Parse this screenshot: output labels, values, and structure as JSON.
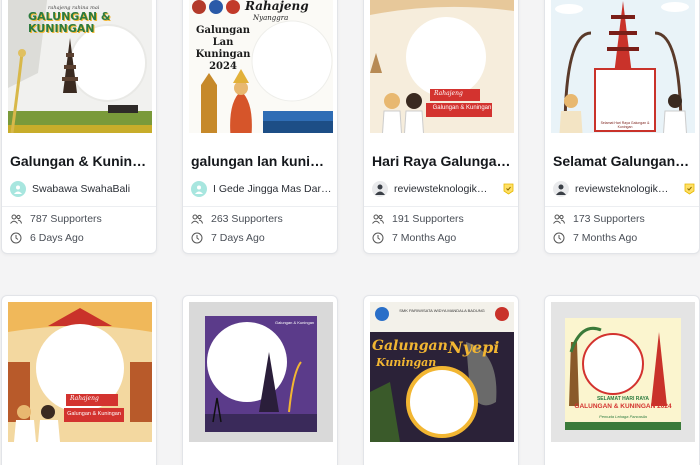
{
  "cards": [
    {
      "title": "Galungan & Kunin…",
      "author": "Swabawa SwahaBali",
      "supporters": "787 Supporters",
      "age": "6 Days Ago",
      "avatar_color": "#a8e6df",
      "verified": false,
      "thumb_text": {
        "top": "rahajeng rahina mai",
        "main": "GALUNGAN & KUNINGAN"
      }
    },
    {
      "title": "galungan lan kunin…",
      "author": "I Gede Jingga Mas Dars…",
      "supporters": "263 Supporters",
      "age": "7 Days Ago",
      "avatar_color": "#a8e6df",
      "verified": false,
      "thumb_text": {
        "top": "Rahajeng",
        "sub": "Nyanggra",
        "main": "Galungan Lan Kuningan 2024"
      }
    },
    {
      "title": "Hari Raya Galunga…",
      "author": "reviewsteknologik…",
      "supporters": "191 Supporters",
      "age": "7 Months Ago",
      "avatar_color": "#3a3f46",
      "verified": true,
      "thumb_text": {
        "top": "Rahajeng",
        "main": "Galungan & Kuningan"
      }
    },
    {
      "title": "Selamat Galungan …",
      "author": "reviewsteknologik…",
      "supporters": "173 Supporters",
      "age": "7 Months Ago",
      "avatar_color": "#3a3f46",
      "verified": true,
      "thumb_text": {
        "top": "Selamat Hari Raya Galungan & Kuningan"
      }
    },
    {
      "title": "",
      "author": "",
      "supporters": "",
      "age": "",
      "avatar_color": "#a8e6df",
      "verified": false,
      "thumb_text": {
        "top": "Rahajeng",
        "main": "Galungan & Kuningan"
      }
    },
    {
      "title": "",
      "author": "",
      "supporters": "",
      "age": "",
      "avatar_color": "#a8e6df",
      "verified": false,
      "thumb_text": {
        "top": "Galungan & Kuningan"
      }
    },
    {
      "title": "",
      "author": "",
      "supporters": "",
      "age": "",
      "avatar_color": "#a8e6df",
      "verified": false,
      "thumb_text": {
        "top": "SMK PARIWISATA WIDYA MANDALA BADUNG",
        "main": "Galungan",
        "sub": "Kuningan",
        "extra": "Nyepi"
      }
    },
    {
      "title": "",
      "author": "",
      "supporters": "",
      "age": "",
      "avatar_color": "#a8e6df",
      "verified": false,
      "thumb_text": {
        "top": "SELAMAT HARI RAYA",
        "main": "GALUNGAN & KUNINGAN 2024",
        "sub": "Pemuda Lebaga Pancasila"
      }
    }
  ],
  "colors": {
    "accent_red": "#d3332f",
    "gold": "#f2b632",
    "text": "#15181c",
    "muted": "#4a4f57"
  }
}
